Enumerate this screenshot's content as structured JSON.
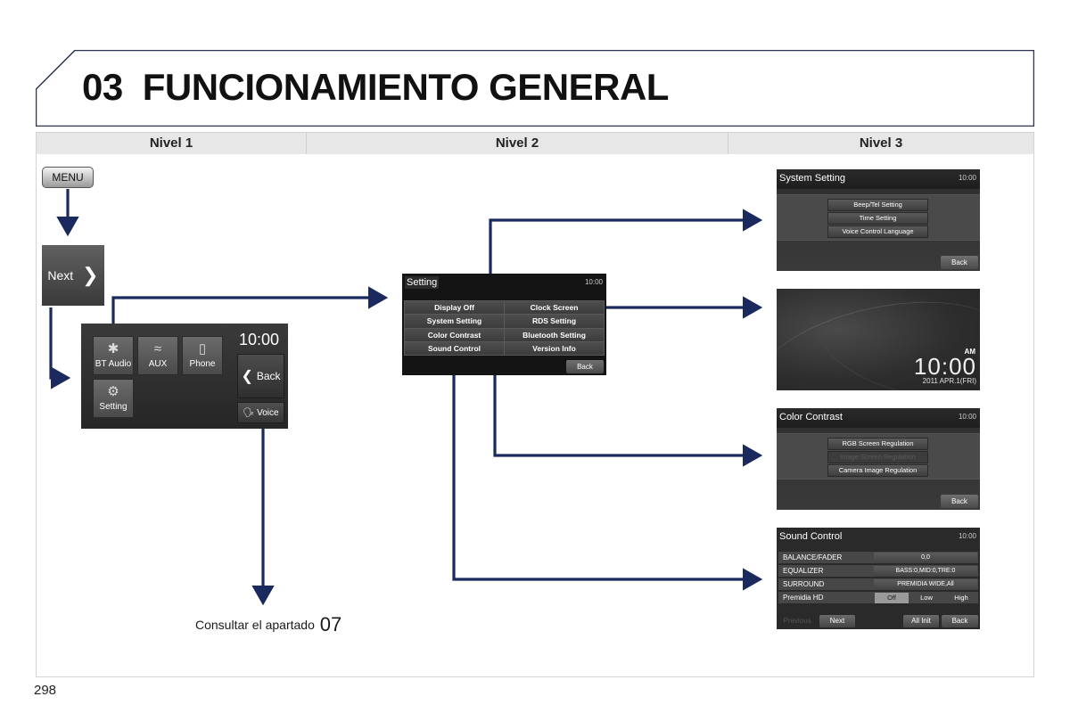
{
  "header": {
    "chapter_number": "03",
    "chapter_title": "FUNCIONAMIENTO GENERAL"
  },
  "levels": [
    "Nivel 1",
    "Nivel 2",
    "Nivel 3"
  ],
  "page_number": "298",
  "colors": {
    "arrow": "#1b2a5e",
    "screen_bg": "#2c2c2c",
    "header_band": "#e7e7e7"
  },
  "level1": {
    "menu_key": "MENU",
    "next_button": {
      "label": "Next",
      "icon": "chevron-right-icon"
    },
    "home_screen": {
      "time": "10:00",
      "tiles": [
        {
          "label": "BT Audio",
          "icon": "bluetooth-icon"
        },
        {
          "label": "AUX",
          "icon": "aux-cable-icon"
        },
        {
          "label": "Phone",
          "icon": "phone-icon"
        },
        {
          "label": "Setting",
          "icon": "gear-icon"
        }
      ],
      "back_label": "Back",
      "voice_label": "Voice"
    },
    "consult_text": "Consultar el apartado",
    "consult_ref": "07"
  },
  "level2": {
    "setting_screen": {
      "title": "Setting",
      "time": "10:00",
      "items": [
        "Display Off",
        "Clock Screen",
        "System Setting",
        "RDS Setting",
        "Color Contrast",
        "Bluetooth Setting",
        "Sound Control",
        "Version Info"
      ],
      "back_label": "Back"
    }
  },
  "level3": {
    "system_setting": {
      "title": "System Setting",
      "time": "10:00",
      "options": [
        "Beep/Tel Setting",
        "Time Setting",
        "Voice Control Language"
      ],
      "back_label": "Back"
    },
    "clock_screen": {
      "ampm": "AM",
      "time": "10:00",
      "date": "2011 APR.1(FRI)"
    },
    "color_contrast": {
      "title": "Color Contrast",
      "time": "10:00",
      "options": [
        {
          "label": "RGB Screen Regulation",
          "enabled": true
        },
        {
          "label": "Image Screen Regulation",
          "enabled": false
        },
        {
          "label": "Camera Image Regulation",
          "enabled": true
        }
      ],
      "back_label": "Back"
    },
    "sound_control": {
      "title": "Sound Control",
      "time": "10:00",
      "rows": [
        {
          "key": "BALANCE/FADER",
          "value": "0,0"
        },
        {
          "key": "EQUALIZER",
          "value": "BASS:0,MID:0,TRE:0"
        },
        {
          "key": "SURROUND",
          "value": "PREMIDIA  WIDE,All"
        }
      ],
      "premidia": {
        "key": "Premidia HD",
        "options": [
          "Off",
          "Low",
          "High"
        ],
        "selected": "Off"
      },
      "buttons": {
        "previous": "Previous",
        "next": "Next",
        "all_init": "All Init",
        "back": "Back"
      }
    }
  }
}
